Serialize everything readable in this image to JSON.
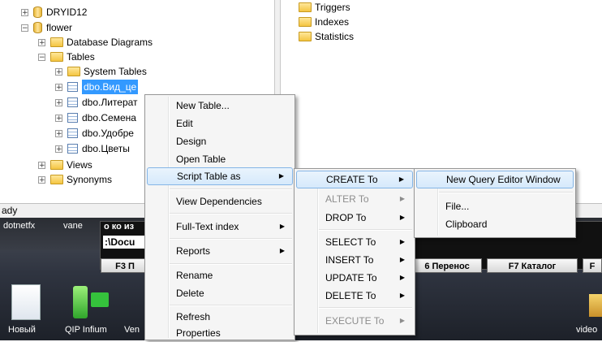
{
  "tree": {
    "items": [
      {
        "label": "DRYID12",
        "expander": "+",
        "icon": "database-icon"
      },
      {
        "label": "flower",
        "expander": "−",
        "icon": "database-icon"
      },
      {
        "label": "Database Diagrams",
        "expander": "+",
        "icon": "folder-icon"
      },
      {
        "label": "Tables",
        "expander": "−",
        "icon": "folder-icon"
      },
      {
        "label": "System Tables",
        "expander": "+",
        "icon": "folder-icon"
      },
      {
        "label": "dbo.Вид_це",
        "expander": "+",
        "icon": "table-icon",
        "selected": true
      },
      {
        "label": "dbo.Литерат",
        "expander": "+",
        "icon": "table-icon"
      },
      {
        "label": "dbo.Семена",
        "expander": "+",
        "icon": "table-icon"
      },
      {
        "label": "dbo.Удобре",
        "expander": "+",
        "icon": "table-icon"
      },
      {
        "label": "dbo.Цветы",
        "expander": "+",
        "icon": "table-icon"
      },
      {
        "label": "Views",
        "expander": "+",
        "icon": "folder-icon"
      },
      {
        "label": "Synonyms",
        "expander": "+",
        "icon": "folder-icon"
      }
    ]
  },
  "detail": {
    "items": [
      {
        "label": "Triggers",
        "icon": "folder-icon"
      },
      {
        "label": "Indexes",
        "icon": "folder-icon"
      },
      {
        "label": "Statistics",
        "icon": "folder-icon"
      }
    ]
  },
  "statusbar": {
    "text": "ady"
  },
  "menu_main": {
    "items": [
      {
        "label": "New Table..."
      },
      {
        "label": "Edit"
      },
      {
        "label": "Design"
      },
      {
        "label": "Open Table"
      },
      {
        "label": "Script Table as",
        "submenu": true,
        "highlighted": true
      },
      {
        "label": "View Dependencies"
      },
      {
        "label": "Full-Text index",
        "submenu": true
      },
      {
        "label": "Reports",
        "submenu": true
      },
      {
        "label": "Rename"
      },
      {
        "label": "Delete"
      },
      {
        "label": "Refresh"
      },
      {
        "label": "Properties"
      }
    ]
  },
  "menu_script": {
    "items": [
      {
        "label": "CREATE To",
        "submenu": true,
        "highlighted": true
      },
      {
        "label": "ALTER To",
        "submenu": true,
        "disabled": true
      },
      {
        "label": "DROP To",
        "submenu": true
      },
      {
        "label": "SELECT To",
        "submenu": true
      },
      {
        "label": "INSERT To",
        "submenu": true
      },
      {
        "label": "UPDATE To",
        "submenu": true
      },
      {
        "label": "DELETE To",
        "submenu": true
      },
      {
        "label": "EXECUTE To",
        "submenu": true,
        "disabled": true
      }
    ]
  },
  "menu_create": {
    "items": [
      {
        "label": "New Query Editor Window",
        "highlighted": true
      },
      {
        "label": "File..."
      },
      {
        "label": "Clipboard"
      }
    ]
  },
  "background": {
    "taskbar_top": [
      "dotnetfx",
      "vane"
    ],
    "console_path": ":\\Docu",
    "console_header": "о ко из",
    "fkeys": [
      "F3 П",
      "6 Перенос",
      "F7 Каталог",
      "F"
    ],
    "desktop_icons": [
      "Новый",
      "QIP Infium",
      "Ven",
      "video"
    ]
  },
  "colors": {
    "selection": "#3399ff",
    "menu_highlight_border": "#84b5e6"
  }
}
